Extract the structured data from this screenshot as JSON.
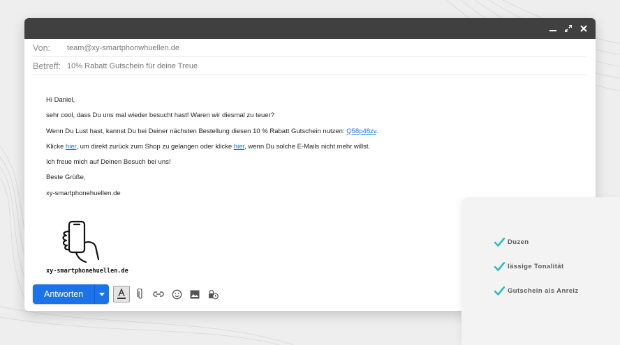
{
  "email": {
    "from_label": "Von:",
    "from_value": "team@xy-smartphonwhuellen.de",
    "subject_label": "Betreff:",
    "subject_value": "10% Rabatt Gutschein für deine Treue",
    "greeting": "Hi Daniel,",
    "line1": "sehr cool, dass Du uns mal wieder besucht hast! Waren wir diesmal zu teuer?",
    "line2_pre": "Wenn Du Lust hast, kannst Du bei Deiner nächsten Bestellung diesen 10 % Rabatt Gutschein nutzen: ",
    "coupon_code": "Q58p48zv",
    "line2_post": ".",
    "line3_a": "Klicke ",
    "link_here_1": "hier",
    "line3_b": ", um direkt zurück zum Shop zu gelangen oder klicke ",
    "link_here_2": "hier",
    "line3_c": ", wenn Du solche E-Mails nicht mehr willst.",
    "line4": "Ich freue mich auf Deinen Besuch bei uns!",
    "closing": "Beste Grüße,",
    "signature": "xy-smartphonehuellen.de",
    "logo_text": "xy-smartphonehuellen.de"
  },
  "toolbar": {
    "reply_label": "Antworten",
    "icons": [
      "format-text-icon",
      "attachment-icon",
      "link-icon",
      "emoji-icon",
      "image-icon",
      "confidential-icon"
    ]
  },
  "window_controls": [
    "minimize-icon",
    "expand-icon",
    "close-icon"
  ],
  "features": [
    {
      "label": "Duzen"
    },
    {
      "label": "lässige Tonalität"
    },
    {
      "label": "Gutschein als Anreiz"
    }
  ],
  "colors": {
    "accent": "#1a73e8",
    "titlebar": "#404040",
    "check": "#2bbdc4"
  }
}
